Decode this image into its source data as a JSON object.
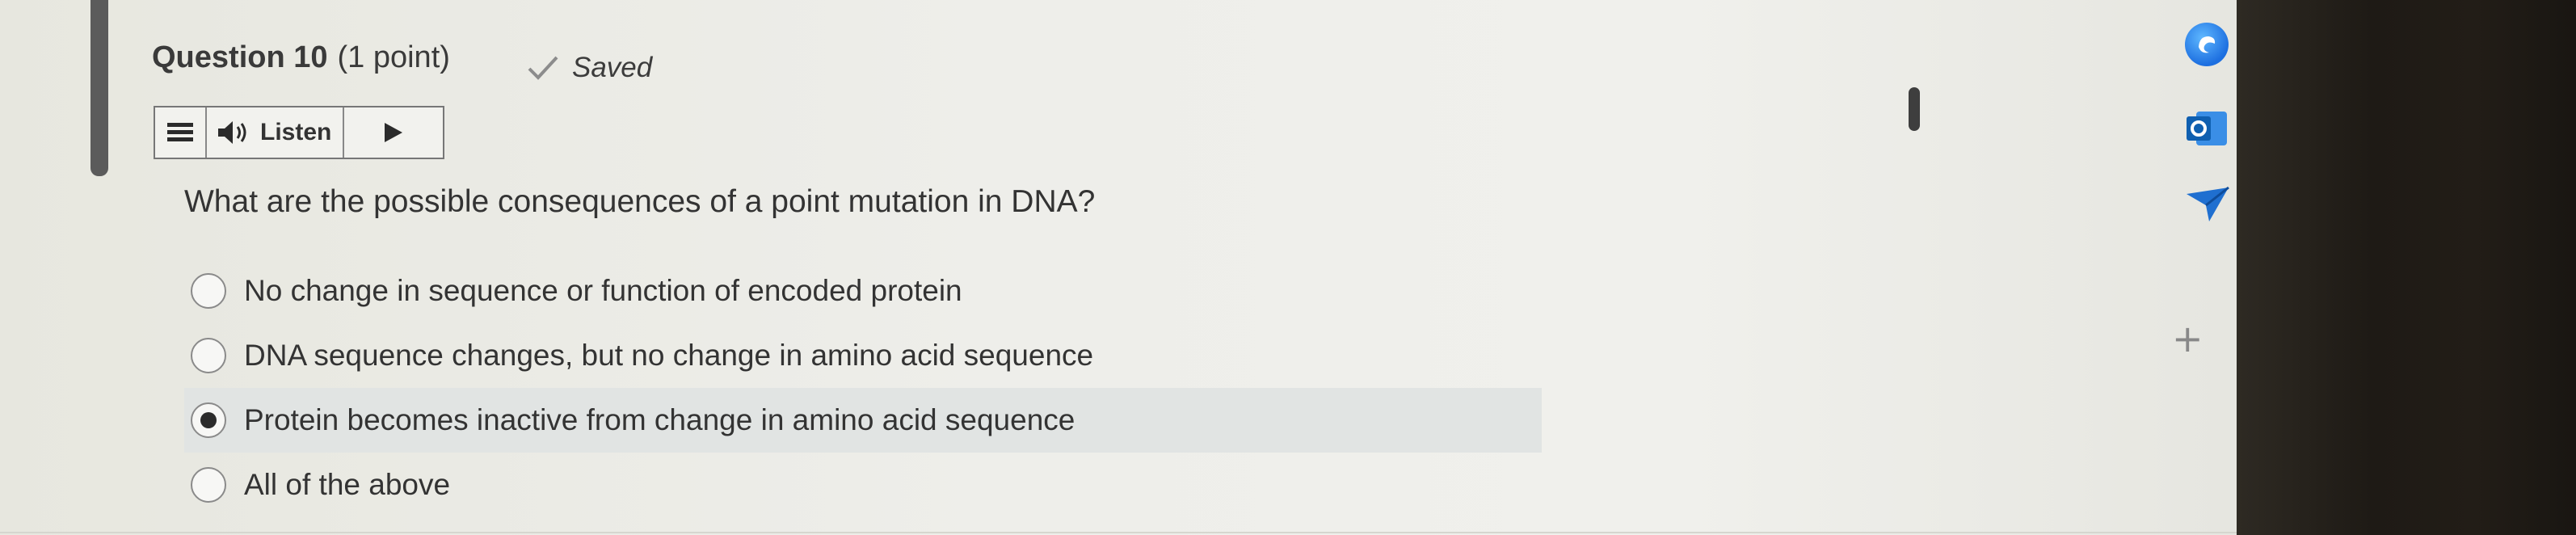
{
  "question": {
    "title": "Question 10",
    "points": "(1 point)",
    "saved_label": "Saved",
    "prompt": "What are the possible consequences of a point mutation in DNA?"
  },
  "toolbar": {
    "listen_label": "Listen"
  },
  "options": [
    {
      "label": "No change in sequence or function of encoded protein",
      "selected": false
    },
    {
      "label": "DNA sequence changes, but no change in amino acid sequence",
      "selected": false
    },
    {
      "label": "Protein becomes inactive from change in amino acid sequence",
      "selected": true
    },
    {
      "label": "All of the above",
      "selected": false
    }
  ],
  "sidebar": {
    "icons": [
      "edge-browser-icon",
      "outlook-icon",
      "send-icon"
    ],
    "add_label": "+"
  },
  "colors": {
    "selected_row": "#e1e4e3",
    "edge_blue": "#1d6fe0",
    "outlook_blue": "#0f6cbd"
  }
}
